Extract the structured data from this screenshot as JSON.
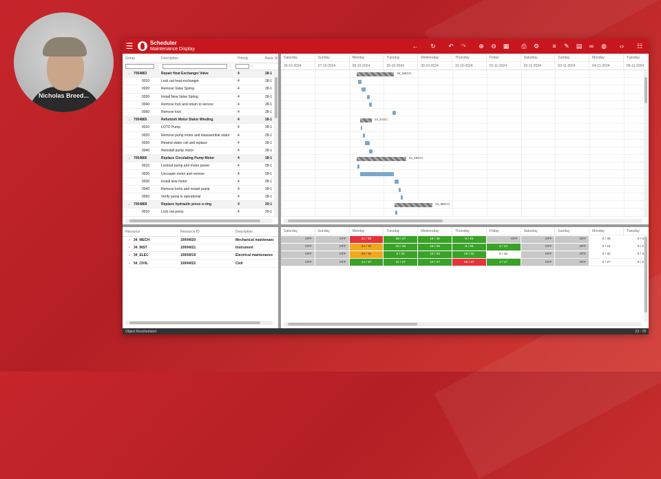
{
  "webcam": {
    "name": "Nicholas Breed..."
  },
  "app": {
    "title": "Scheduler",
    "subtitle": "Maintenance Display",
    "colors": {
      "brand": "#c8161e",
      "summary_bar": "#888888",
      "task_bar": "#7aa7c9",
      "off": "#c8c8c8",
      "ok": "#3aa229",
      "warn": "#f2a81d",
      "over": "#e8323a"
    },
    "toolbar_icons": [
      "back-arrow-icon",
      "refresh-icon",
      "undo-icon",
      "redo-icon",
      "zoom-in-icon",
      "zoom-out-icon",
      "zoom-fit-icon",
      "print-icon",
      "settings-icon",
      "list-icon",
      "edit-icon",
      "calendar-icon",
      "link-icon",
      "globe-icon",
      "code-icon",
      "menu-list-icon"
    ]
  },
  "work_grid": {
    "columns": [
      "Group",
      "Description",
      "Priority",
      "Basic Sta"
    ],
    "rows": [
      {
        "group": "7054863",
        "desc": "Repair Heat Exchanger Valve",
        "priority": "4",
        "start": "28-1",
        "is_group": true
      },
      {
        "group": "0010",
        "desc": "Lock out heat exchanger",
        "priority": "4",
        "start": "28-1",
        "is_group": false
      },
      {
        "group": "0020",
        "desc": "Remove Valve Spring",
        "priority": "4",
        "start": "28-1",
        "is_group": false
      },
      {
        "group": "0030",
        "desc": "Install New Valve Spring",
        "priority": "4",
        "start": "28-1",
        "is_group": false
      },
      {
        "group": "0040",
        "desc": "Remove lock and return to service",
        "priority": "4",
        "start": "28-1",
        "is_group": false
      },
      {
        "group": "0050",
        "desc": "Remove lock",
        "priority": "4",
        "start": "28-1",
        "is_group": false
      },
      {
        "group": "7054865",
        "desc": "Refurbish Motor Stator Winding",
        "priority": "4",
        "start": "28-1",
        "is_group": true
      },
      {
        "group": "0010",
        "desc": "LOTO Pump",
        "priority": "4",
        "start": "28-1",
        "is_group": false
      },
      {
        "group": "0020",
        "desc": "Remove pump motor and disassemble stator",
        "priority": "4",
        "start": "28-1",
        "is_group": false
      },
      {
        "group": "0030",
        "desc": "Rewind stator coil and replace",
        "priority": "4",
        "start": "28-1",
        "is_group": false
      },
      {
        "group": "0040",
        "desc": "Reinstall pump motor",
        "priority": "4",
        "start": "28-1",
        "is_group": false
      },
      {
        "group": "7054866",
        "desc": "Replace Circulating Pump Motor",
        "priority": "4",
        "start": "28-1",
        "is_group": true
      },
      {
        "group": "0010",
        "desc": "Lockout pump and motor power",
        "priority": "4",
        "start": "28-1",
        "is_group": false
      },
      {
        "group": "0020",
        "desc": "Uncouple motor and remove",
        "priority": "4",
        "start": "28-1",
        "is_group": false
      },
      {
        "group": "0030",
        "desc": "Install new motor",
        "priority": "4",
        "start": "28-1",
        "is_group": false
      },
      {
        "group": "0040",
        "desc": "Remove locks and restart pump",
        "priority": "4",
        "start": "28-1",
        "is_group": false
      },
      {
        "group": "0050",
        "desc": "Verify pump is operational",
        "priority": "4",
        "start": "28-1",
        "is_group": false
      },
      {
        "group": "7054869",
        "desc": "Replace hydraulic press o-ring",
        "priority": "4",
        "start": "29-1",
        "is_group": true
      },
      {
        "group": "0010",
        "desc": "Lock out press",
        "priority": "4",
        "start": "29-1",
        "is_group": false
      }
    ]
  },
  "timeline": {
    "days": [
      {
        "dow": "Saturday",
        "date": "26-10-2024"
      },
      {
        "dow": "Sunday",
        "date": "27-10-2024"
      },
      {
        "dow": "Monday",
        "date": "28-10-2024"
      },
      {
        "dow": "Tuesday",
        "date": "29-10-2024"
      },
      {
        "dow": "Wednesday",
        "date": "30-10-2024"
      },
      {
        "dow": "Thursday",
        "date": "31-10-2024"
      },
      {
        "dow": "Friday",
        "date": "01-11-2024"
      },
      {
        "dow": "Saturday",
        "date": "02-11-2024"
      },
      {
        "dow": "Sunday",
        "date": "03-11-2024"
      },
      {
        "dow": "Monday",
        "date": "04-11-2024"
      },
      {
        "dow": "Tuesday",
        "date": "05-11-2024"
      }
    ]
  },
  "gantt_bars": [
    {
      "row": 0,
      "start_day": 2.2,
      "span_days": 1.1,
      "summary": true,
      "label": "34_MECH"
    },
    {
      "row": 1,
      "start_day": 2.25,
      "span_days": 0.1,
      "summary": false,
      "label": ""
    },
    {
      "row": 2,
      "start_day": 2.35,
      "span_days": 0.12,
      "summary": false,
      "label": ""
    },
    {
      "row": 3,
      "start_day": 2.5,
      "span_days": 0.1,
      "summary": false,
      "label": ""
    },
    {
      "row": 4,
      "start_day": 2.58,
      "span_days": 0.08,
      "summary": false,
      "label": ""
    },
    {
      "row": 5,
      "start_day": 3.25,
      "span_days": 0.1,
      "summary": false,
      "label": ""
    },
    {
      "row": 6,
      "start_day": 2.3,
      "span_days": 0.35,
      "summary": true,
      "label": "34_ELEC"
    },
    {
      "row": 7,
      "start_day": 2.32,
      "span_days": 0.05,
      "summary": false,
      "label": ""
    },
    {
      "row": 8,
      "start_day": 2.38,
      "span_days": 0.06,
      "summary": false,
      "label": ""
    },
    {
      "row": 9,
      "start_day": 2.44,
      "span_days": 0.16,
      "summary": false,
      "label": ""
    },
    {
      "row": 10,
      "start_day": 2.58,
      "span_days": 0.1,
      "summary": false,
      "label": ""
    },
    {
      "row": 11,
      "start_day": 2.2,
      "span_days": 1.45,
      "summary": true,
      "label": "34_MECH"
    },
    {
      "row": 12,
      "start_day": 2.22,
      "span_days": 0.06,
      "summary": false,
      "label": ""
    },
    {
      "row": 13,
      "start_day": 2.3,
      "span_days": 1.0,
      "summary": false,
      "label": ""
    },
    {
      "row": 14,
      "start_day": 3.32,
      "span_days": 0.12,
      "summary": false,
      "label": ""
    },
    {
      "row": 15,
      "start_day": 3.44,
      "span_days": 0.06,
      "summary": false,
      "label": ""
    },
    {
      "row": 16,
      "start_day": 3.5,
      "span_days": 0.06,
      "summary": false,
      "label": ""
    },
    {
      "row": 17,
      "start_day": 3.32,
      "span_days": 1.1,
      "summary": true,
      "label": "34_MECH"
    },
    {
      "row": 18,
      "start_day": 3.34,
      "span_days": 0.06,
      "summary": false,
      "label": ""
    }
  ],
  "resources": {
    "columns": [
      "Resource",
      "Resource ID",
      "Description"
    ],
    "rows": [
      {
        "name": "34_MECH",
        "id": "10004020",
        "desc": "Mechanical maintenanc"
      },
      {
        "name": "34_INST",
        "id": "10004021",
        "desc": "Instrument"
      },
      {
        "name": "34_ELEC",
        "id": "10004019",
        "desc": "Electrical maintenance"
      },
      {
        "name": "54_CIVIL",
        "id": "10004022",
        "desc": "Civil"
      }
    ],
    "load": [
      [
        {
          "t": "OFF",
          "s": "off"
        },
        {
          "t": "OFF",
          "s": "off"
        },
        {
          "t": "41 / 36",
          "s": "over"
        },
        {
          "t": "28 / 47",
          "s": "ok"
        },
        {
          "t": "18 / 45",
          "s": "ok"
        },
        {
          "t": "8 / 45",
          "s": "ok"
        },
        {
          "t": "OFF",
          "s": "off"
        },
        {
          "t": "OFF",
          "s": "off"
        },
        {
          "t": "OFF",
          "s": "off"
        },
        {
          "t": "0 / 45",
          "s": "none"
        },
        {
          "t": "0 / 4",
          "s": "none"
        }
      ],
      [
        {
          "t": "OFF",
          "s": "off"
        },
        {
          "t": "OFF",
          "s": "off"
        },
        {
          "t": "34 / 32",
          "s": "warn"
        },
        {
          "t": "10 / 36",
          "s": "ok"
        },
        {
          "t": "16 / 36",
          "s": "ok"
        },
        {
          "t": "8 / 36",
          "s": "ok"
        },
        {
          "t": "6 / 24",
          "s": "ok"
        },
        {
          "t": "OFF",
          "s": "off"
        },
        {
          "t": "OFF",
          "s": "off"
        },
        {
          "t": "0 / 24",
          "s": "none"
        },
        {
          "t": "0 / 2",
          "s": "none"
        }
      ],
      [
        {
          "t": "OFF",
          "s": "off"
        },
        {
          "t": "OFF",
          "s": "off"
        },
        {
          "t": "29 / 32",
          "s": "warn"
        },
        {
          "t": "5 / 32",
          "s": "ok"
        },
        {
          "t": "15 / 32",
          "s": "ok"
        },
        {
          "t": "25 / 32",
          "s": "ok"
        },
        {
          "t": "0 / 32",
          "s": "none"
        },
        {
          "t": "OFF",
          "s": "off"
        },
        {
          "t": "OFF",
          "s": "off"
        },
        {
          "t": "0 / 32",
          "s": "none"
        },
        {
          "t": "0 / 3",
          "s": "none"
        }
      ],
      [
        {
          "t": "OFF",
          "s": "off"
        },
        {
          "t": "OFF",
          "s": "off"
        },
        {
          "t": "14 / 27",
          "s": "ok"
        },
        {
          "t": "11 / 27",
          "s": "ok"
        },
        {
          "t": "16 / 27",
          "s": "ok"
        },
        {
          "t": "35 / 27",
          "s": "over"
        },
        {
          "t": "4 / 27",
          "s": "ok"
        },
        {
          "t": "OFF",
          "s": "off"
        },
        {
          "t": "OFF",
          "s": "off"
        },
        {
          "t": "0 / 27",
          "s": "none"
        },
        {
          "t": "0 / 2",
          "s": "none"
        }
      ]
    ]
  },
  "status": {
    "message": "Object Rescheduled",
    "range": "23 - 78"
  }
}
